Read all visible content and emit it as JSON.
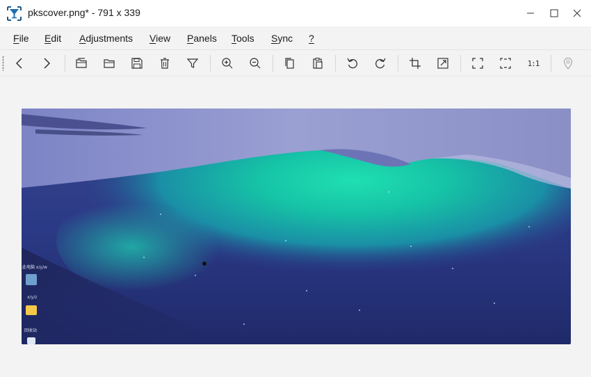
{
  "window": {
    "title": "pkscover.png* - 791 x 339",
    "app_icon": "funnel-glass-icon",
    "controls": [
      "minimize-icon",
      "maximize-icon",
      "close-icon"
    ]
  },
  "menu": {
    "items": [
      {
        "label": "File",
        "underline": "F",
        "rest": "ile"
      },
      {
        "label": "Edit",
        "underline": "E",
        "rest": "dit"
      },
      {
        "label": "Adjustments",
        "underline": "A",
        "rest": "djustments"
      },
      {
        "label": "View",
        "underline": "V",
        "rest": "iew"
      },
      {
        "label": "Panels",
        "underline": "P",
        "rest": "anels"
      },
      {
        "label": "Tools",
        "underline": "T",
        "rest": "ools"
      },
      {
        "label": "Sync",
        "underline": "S",
        "rest": "ync"
      },
      {
        "label": "?",
        "underline": "?",
        "rest": ""
      }
    ]
  },
  "toolbar": {
    "buttons": [
      "previous-icon",
      "next-icon",
      "open-recent-icon",
      "open-folder-icon",
      "save-icon",
      "delete-icon",
      "filter-icon",
      "zoom-in-icon",
      "zoom-out-icon",
      "copy-icon",
      "paste-icon",
      "rotate-left-icon",
      "rotate-right-icon",
      "crop-icon",
      "resize-icon",
      "fullscreen-icon",
      "fit-selection-icon",
      "actual-size-icon",
      "location-pin-icon"
    ],
    "actual_size_label": "1:1"
  },
  "image": {
    "description_colors": {
      "sky": "#2a2f72",
      "aurora": "#14c9a3",
      "glacier": "#8a90c8"
    },
    "desktop_labels": [
      "此电脑 x/y/w",
      "x/y/z",
      "回收站"
    ]
  }
}
